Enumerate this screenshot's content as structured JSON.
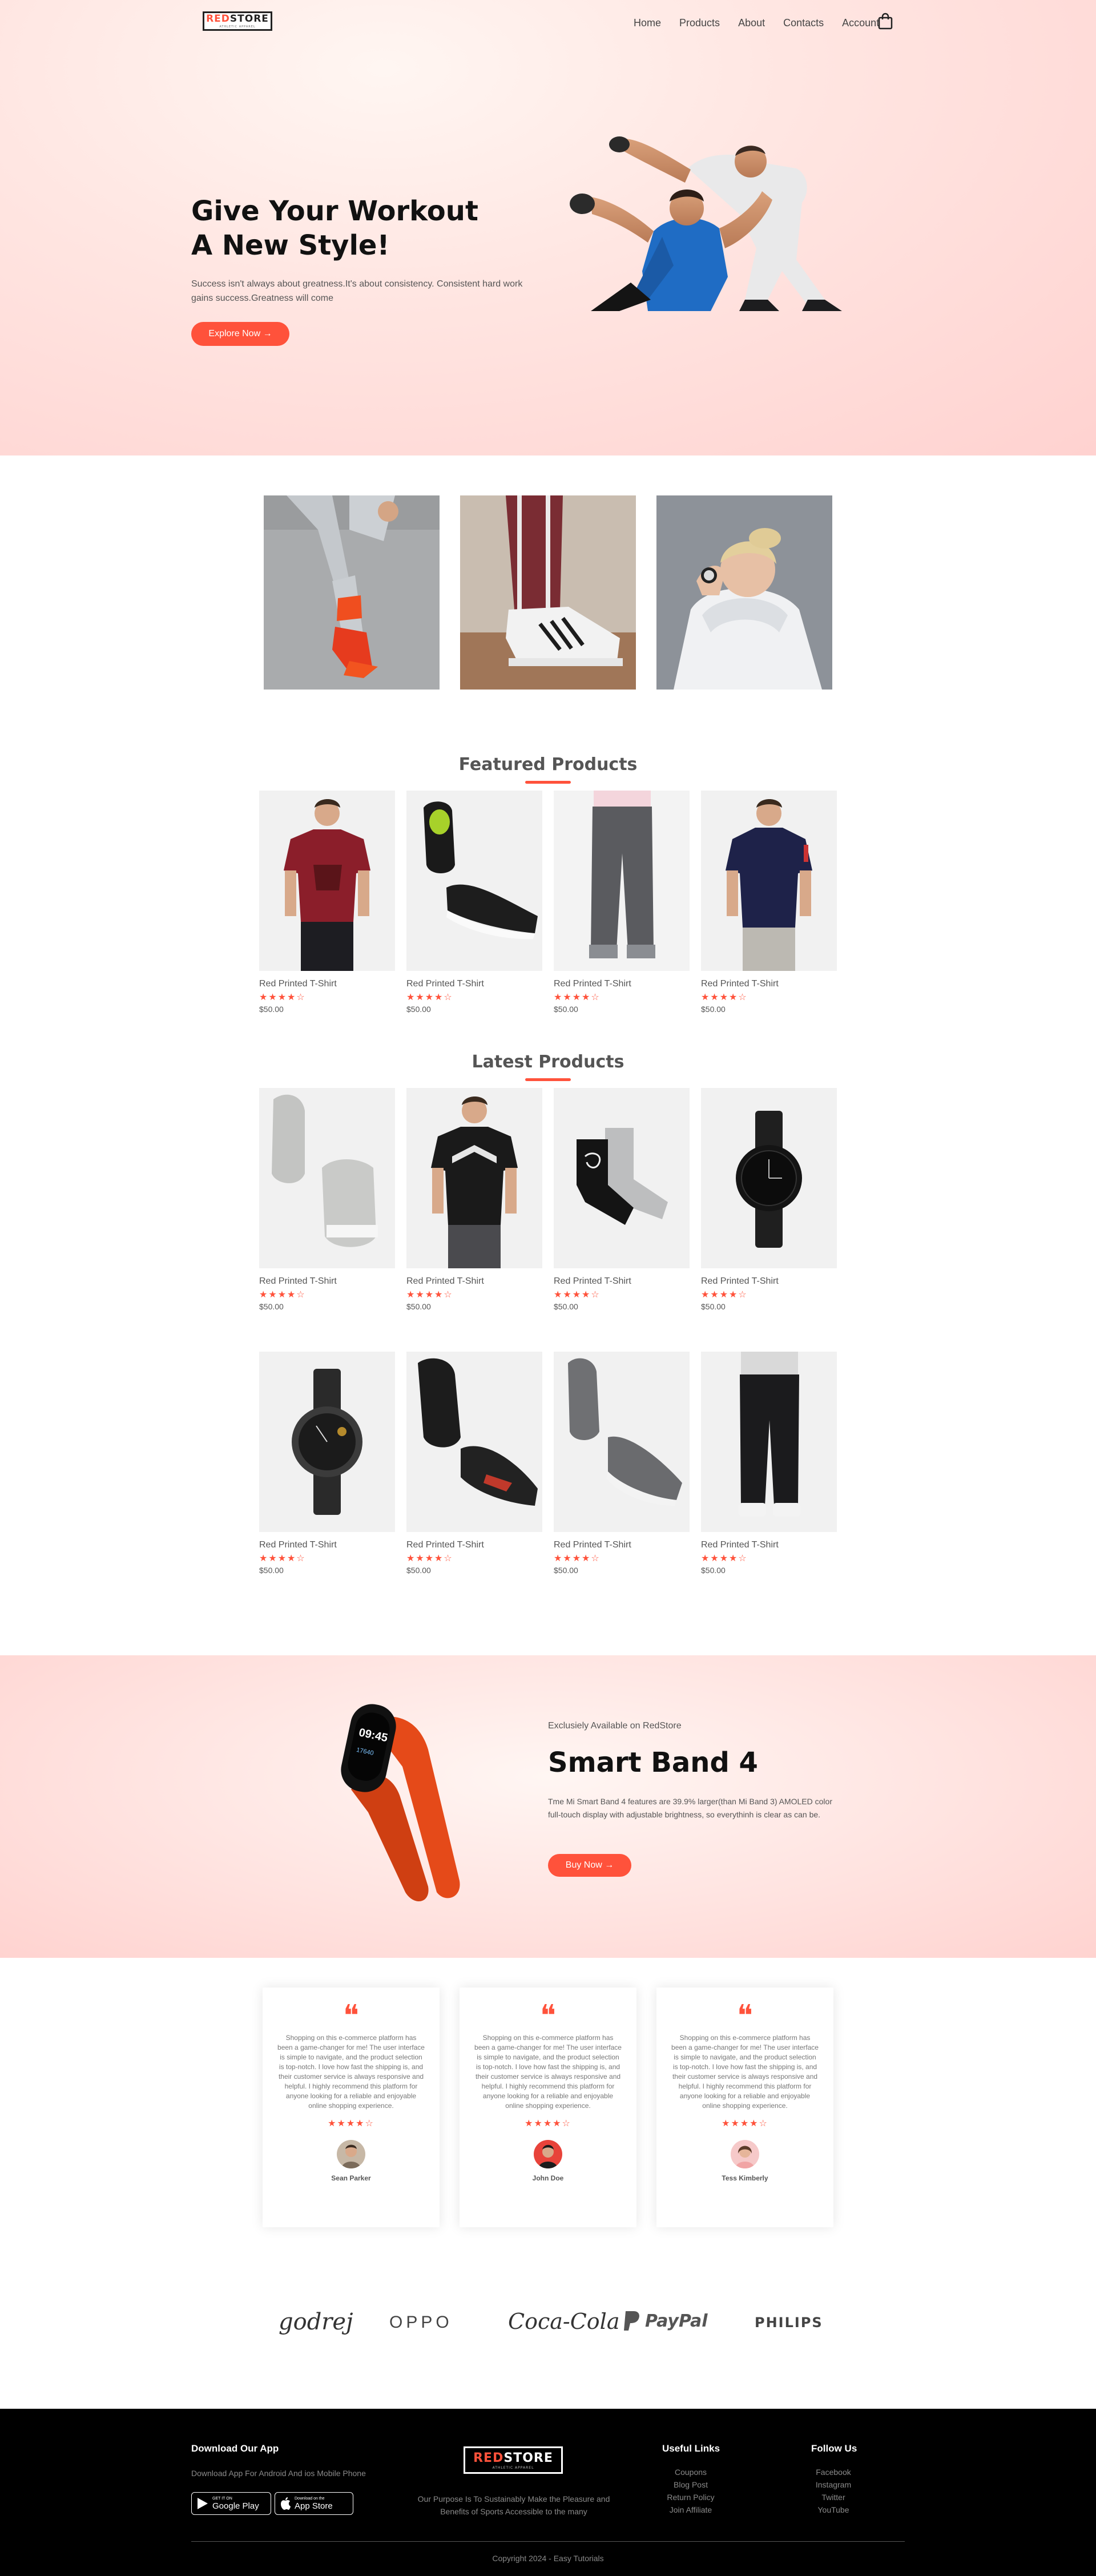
{
  "header": {
    "logo": {
      "red": "RED",
      "black": "STORE",
      "tagline": "ATHLETIC APPAREL"
    },
    "nav": [
      "Home",
      "Products",
      "About",
      "Contacts",
      "Account"
    ]
  },
  "hero": {
    "title_line1": "Give Your Workout",
    "title_line2": "A New Style!",
    "text": "Success isn't always about greatness.It's about consistency. Consistent hard work gains success.Greatness will come",
    "button": "Explore Now →"
  },
  "featured": {
    "title": "Featured Products",
    "products": [
      {
        "name": "Red Printed T-Shirt",
        "stars": "★★★★☆",
        "price": "$50.00"
      },
      {
        "name": "Red Printed T-Shirt",
        "stars": "★★★★☆",
        "price": "$50.00"
      },
      {
        "name": "Red Printed T-Shirt",
        "stars": "★★★★☆",
        "price": "$50.00"
      },
      {
        "name": "Red Printed T-Shirt",
        "stars": "★★★★☆",
        "price": "$50.00"
      }
    ]
  },
  "latest": {
    "title": "Latest Products",
    "products": [
      {
        "name": "Red Printed T-Shirt",
        "stars": "★★★★☆",
        "price": "$50.00"
      },
      {
        "name": "Red Printed T-Shirt",
        "stars": "★★★★☆",
        "price": "$50.00"
      },
      {
        "name": "Red Printed T-Shirt",
        "stars": "★★★★☆",
        "price": "$50.00"
      },
      {
        "name": "Red Printed T-Shirt",
        "stars": "★★★★☆",
        "price": "$50.00"
      },
      {
        "name": "Red Printed T-Shirt",
        "stars": "★★★★☆",
        "price": "$50.00"
      },
      {
        "name": "Red Printed T-Shirt",
        "stars": "★★★★☆",
        "price": "$50.00"
      },
      {
        "name": "Red Printed T-Shirt",
        "stars": "★★★★☆",
        "price": "$50.00"
      },
      {
        "name": "Red Printed T-Shirt",
        "stars": "★★★★☆",
        "price": "$50.00"
      }
    ]
  },
  "offer": {
    "subtitle": "Exclusiely Available on RedStore",
    "title": "Smart Band 4",
    "text": "Tme Mi Smart Band 4 features are 39.9% larger(than Mi Band 3) AMOLED color full-touch display with adjustable brightness, so everythinh is clear as can be.",
    "button": "Buy Now →",
    "watch_time": "09:45",
    "watch_steps": "17640"
  },
  "testimonials": [
    {
      "text": "Shopping on this e-commerce platform has been a game-changer for me! The user interface is simple to navigate, and the product selection is top-notch. I love how fast the shipping is, and their customer service is always responsive and helpful. I highly recommend this platform for anyone looking for a reliable and enjoyable online shopping experience.",
      "stars": "★★★★☆",
      "name": "Sean Parker"
    },
    {
      "text": "Shopping on this e-commerce platform has been a game-changer for me! The user interface is simple to navigate, and the product selection is top-notch. I love how fast the shipping is, and their customer service is always responsive and helpful. I highly recommend this platform for anyone looking for a reliable and enjoyable online shopping experience.",
      "stars": "★★★★☆",
      "name": "John Doe"
    },
    {
      "text": "Shopping on this e-commerce platform has been a game-changer for me! The user interface is simple to navigate, and the product selection is top-notch. I love how fast the shipping is, and their customer service is always responsive and helpful. I highly recommend this platform for anyone looking for a reliable and enjoyable online shopping experience.",
      "stars": "★★★★☆",
      "name": "Tess Kimberly"
    }
  ],
  "brands": [
    "godrej",
    "OPPO",
    "Coca-Cola",
    "PayPal",
    "PHILIPS"
  ],
  "footer": {
    "download_title": "Download Our App",
    "download_text": "Download App For Android And ios Mobile Phone",
    "google_small": "GET IT ON",
    "google_big": "Google Play",
    "apple_small": "Download on the",
    "apple_big": "App Store",
    "purpose": "Our Purpose Is To Sustainably Make the Pleasure and Benefits of Sports Accessible to the many",
    "useful_title": "Useful Links",
    "useful_links": [
      "Coupons",
      "Blog Post",
      "Return Policy",
      "Join Affiliate"
    ],
    "follow_title": "Follow Us",
    "follow_links": [
      "Facebook",
      "Instagram",
      "Twitter",
      "YouTube"
    ],
    "copyright": "Copyright 2024 - Easy Tutorials"
  },
  "colors": {
    "accent": "#ff523b",
    "hero_bg": "#ffe3e0",
    "footer_bg": "#000000"
  }
}
